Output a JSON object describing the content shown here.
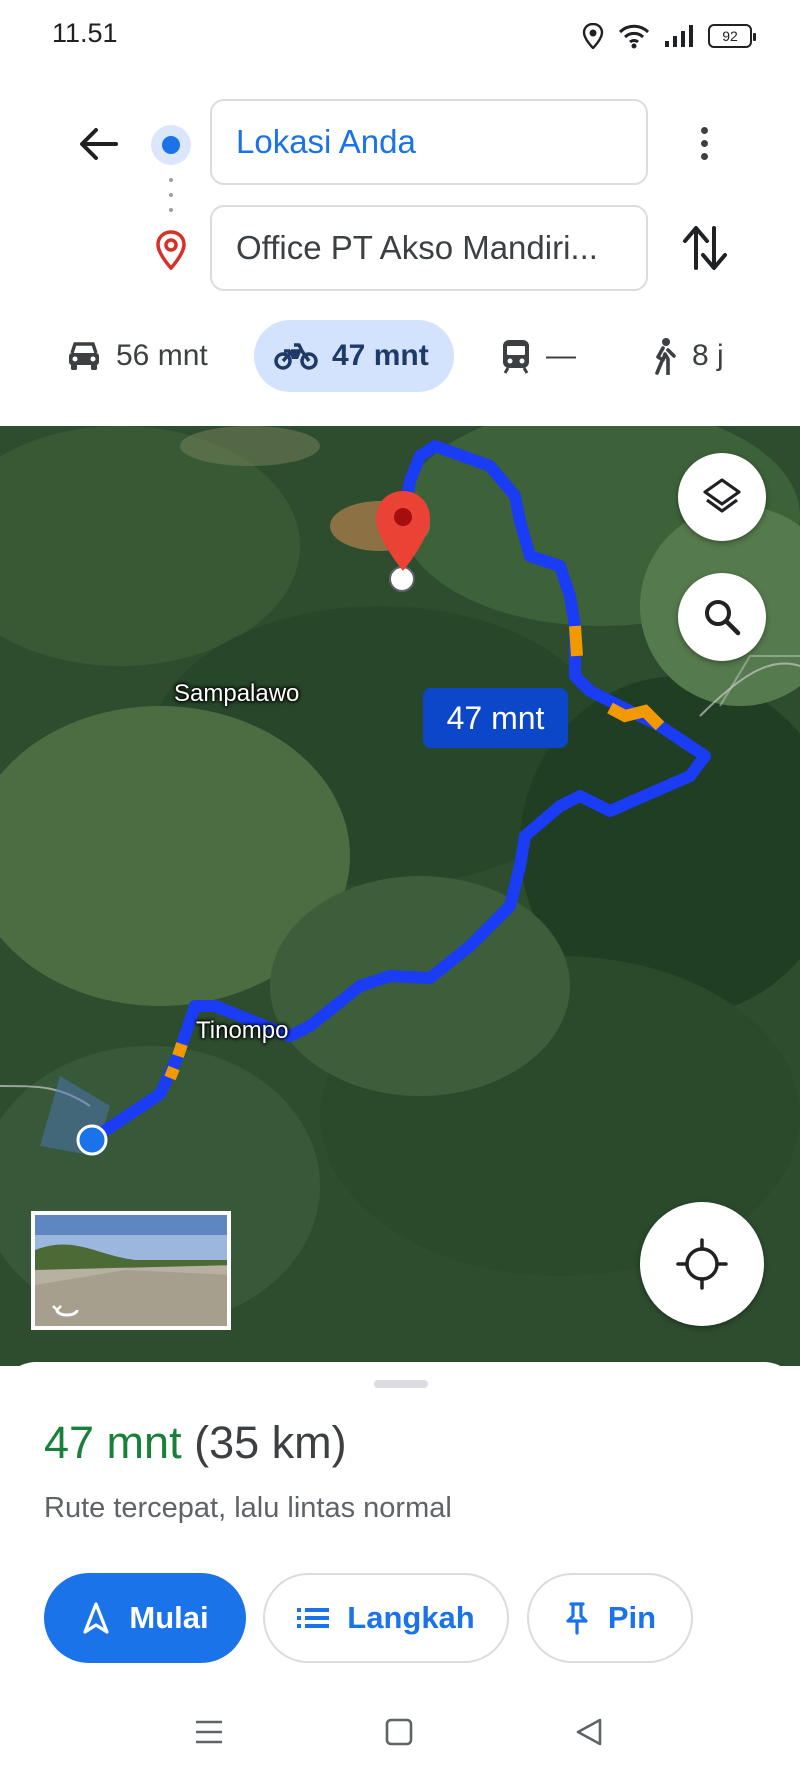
{
  "status_bar": {
    "time": "11.51",
    "battery": "92"
  },
  "route": {
    "origin": "Lokasi Anda",
    "destination": "Office PT Akso Mandiri..."
  },
  "modes": [
    {
      "icon": "car-icon",
      "label": "56 mnt"
    },
    {
      "icon": "motorcycle-icon",
      "label": "47 mnt",
      "selected": true
    },
    {
      "icon": "transit-icon",
      "label": "—"
    },
    {
      "icon": "walk-icon",
      "label": "8 j"
    }
  ],
  "map": {
    "places": [
      "Sampalawo",
      "Tinompo"
    ],
    "route_duration": "47 mnt"
  },
  "summary": {
    "time": "47 mnt",
    "distance": "(35 km)",
    "description": "Rute tercepat, lalu lintas normal"
  },
  "actions": {
    "start": "Mulai",
    "steps": "Langkah",
    "pin": "Pin"
  },
  "colors": {
    "accent": "#1a73e8",
    "route": "#1a3cf5",
    "traffic": "#f29900",
    "time_green": "#188038",
    "destination_pin": "#ea4335"
  }
}
